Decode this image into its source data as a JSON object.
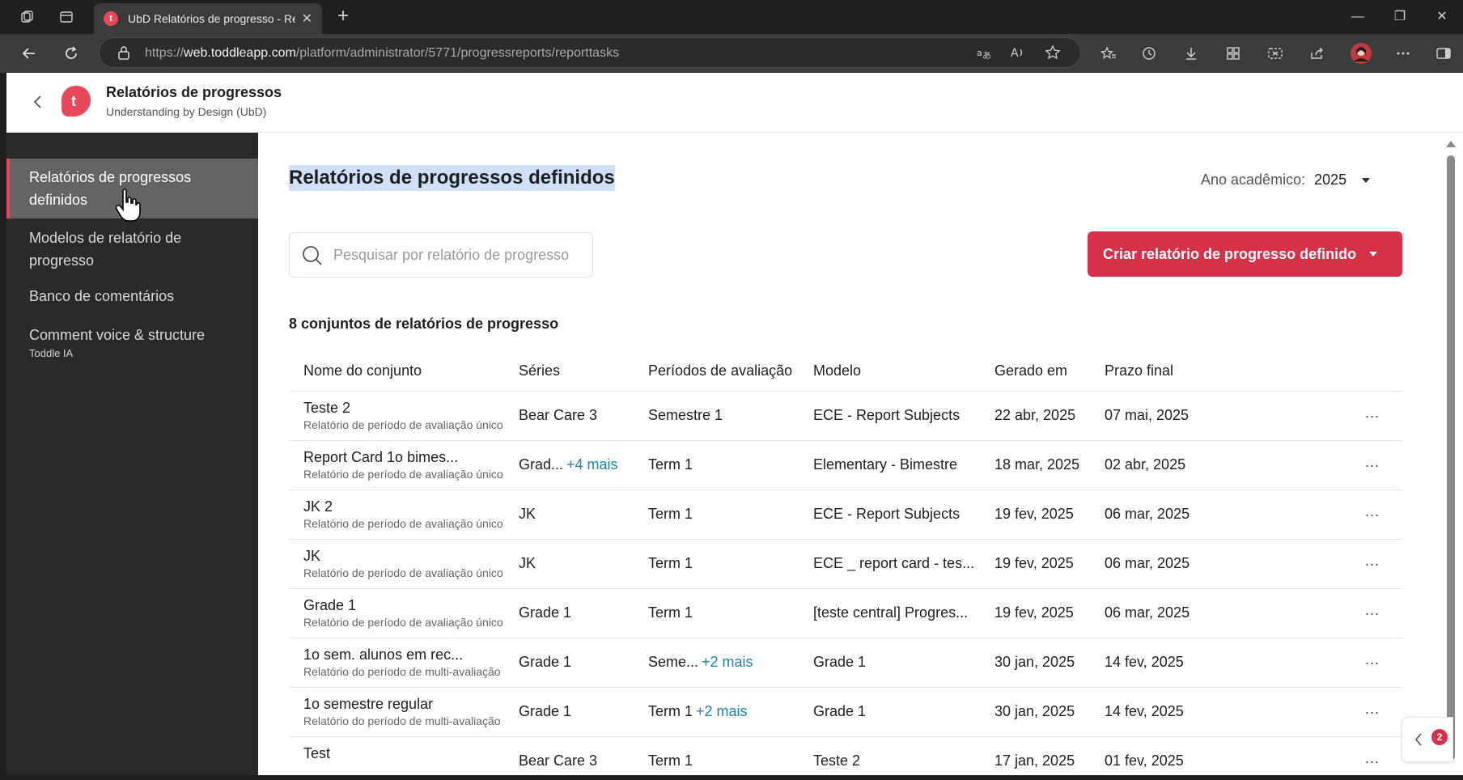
{
  "browser": {
    "tab_title": "UbD Relatórios de progresso - Re",
    "tab_favicon_letter": "t",
    "url_prefix": "https://",
    "url_host": "web.toddleapp.com",
    "url_path": "/platform/administrator/5771/progressreports/reporttasks",
    "profile_icon": "avatar"
  },
  "header": {
    "title": "Relatórios de progressos",
    "subtitle": "Understanding by Design (UbD)",
    "logo_letter": "t",
    "brand_color": "#e9475a"
  },
  "sidebar": {
    "items": [
      {
        "label": "Relatórios de progressos definidos",
        "active": true
      },
      {
        "label": "Modelos de relatório de progresso",
        "active": false
      },
      {
        "label": "Banco de comentários",
        "active": false
      },
      {
        "label": "Comment voice & structure",
        "sub": "Toddle IA",
        "active": false
      }
    ]
  },
  "main": {
    "title": "Relatórios de progressos definidos",
    "year_label": "Ano acadêmico:",
    "year_value": "2025",
    "search_placeholder": "Pesquisar por relatório de progresso",
    "create_button": "Criar relatório de progresso definido",
    "count_text": "8 conjuntos de relatórios de progresso",
    "accent_color": "#d6304b",
    "link_color": "#1f82a8"
  },
  "table": {
    "headers": [
      "Nome do conjunto",
      "Séries",
      "Períodos de avaliação",
      "Modelo",
      "Gerado em",
      "Prazo final"
    ],
    "rows": [
      {
        "name": "Teste 2",
        "sub": "Relatório de período de avaliação único",
        "series": "Bear Care 3",
        "series_more": "",
        "periods": "Semestre 1",
        "periods_more": "",
        "model": "ECE - Report Subjects",
        "generated": "22 abr, 2025",
        "deadline": "07 mai, 2025"
      },
      {
        "name": "Report Card 1o bimes...",
        "sub": "Relatório de período de avaliação único",
        "series": "Grad...",
        "series_more": "+4 mais",
        "periods": "Term 1",
        "periods_more": "",
        "model": "Elementary - Bimestre",
        "generated": "18 mar, 2025",
        "deadline": "02 abr, 2025"
      },
      {
        "name": "JK 2",
        "sub": "Relatório de período de avaliação único",
        "series": "JK",
        "series_more": "",
        "periods": "Term 1",
        "periods_more": "",
        "model": "ECE - Report Subjects",
        "generated": "19 fev, 2025",
        "deadline": "06 mar, 2025"
      },
      {
        "name": "JK",
        "sub": "Relatório de período de avaliação único",
        "series": "JK",
        "series_more": "",
        "periods": "Term 1",
        "periods_more": "",
        "model": "ECE _ report card - tes...",
        "generated": "19 fev, 2025",
        "deadline": "06 mar, 2025"
      },
      {
        "name": "Grade 1",
        "sub": "Relatório de período de avaliação único",
        "series": "Grade 1",
        "series_more": "",
        "periods": "Term 1",
        "periods_more": "",
        "model": "[teste central] Progres...",
        "generated": "19 fev, 2025",
        "deadline": "06 mar, 2025"
      },
      {
        "name": "1o sem. alunos em rec...",
        "sub": "Relatório do período de multi-avaliação",
        "series": "Grade 1",
        "series_more": "",
        "periods": "Seme...",
        "periods_more": "+2 mais",
        "model": "Grade 1",
        "generated": "30 jan, 2025",
        "deadline": "14 fev, 2025"
      },
      {
        "name": "1o semestre regular",
        "sub": "Relatório do período de multi-avaliação",
        "series": "Grade 1",
        "series_more": "",
        "periods": "Term 1",
        "periods_more": "+2 mais",
        "model": "Grade 1",
        "generated": "30 jan, 2025",
        "deadline": "14 fev, 2025"
      },
      {
        "name": "Test",
        "sub": "",
        "series": "Bear Care 3",
        "series_more": "",
        "periods": "Term 1",
        "periods_more": "",
        "model": "Teste 2",
        "generated": "17 jan, 2025",
        "deadline": "01 fev, 2025"
      }
    ],
    "row_menu": "..."
  },
  "help": {
    "badge_count": "2"
  }
}
